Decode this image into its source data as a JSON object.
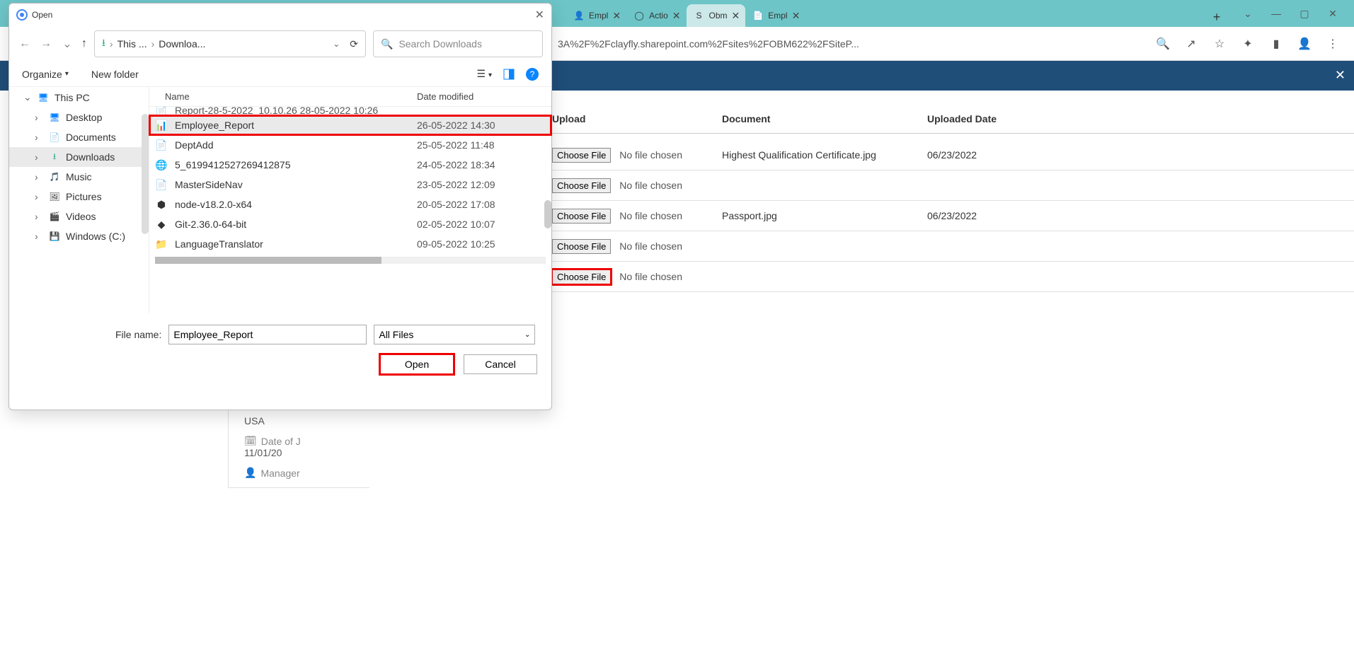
{
  "browser": {
    "tabs": [
      {
        "label": "Empl",
        "favicon": "user-blue"
      },
      {
        "label": "Actio",
        "favicon": "github"
      },
      {
        "label": "Obm",
        "favicon": "sharepoint",
        "active": true
      },
      {
        "label": "Empl",
        "favicon": "file"
      }
    ],
    "url": "3A%2F%2Fclayfly.sharepoint.com%2Fsites%2FOBM622%2FSiteP..."
  },
  "page": {
    "headers": {
      "upload": "Upload",
      "document": "Document",
      "uploaded_date": "Uploaded Date"
    },
    "choose_file_label": "Choose File",
    "no_file_text": "No file chosen",
    "rows": [
      {
        "doc": "Highest Qualification Certificate.jpg",
        "date": "06/23/2022",
        "highlight": false
      },
      {
        "doc": "",
        "date": "",
        "highlight": false
      },
      {
        "doc": "Passport.jpg",
        "date": "06/23/2022",
        "highlight": false
      },
      {
        "doc": "",
        "date": "",
        "highlight": false
      },
      {
        "doc": "",
        "date": "",
        "highlight": true
      }
    ],
    "extra": {
      "country": "USA",
      "doj_label": "Date of J",
      "doj_value": "11/01/20",
      "manager_label": "Manager"
    }
  },
  "dialog": {
    "title": "Open",
    "breadcrumb": {
      "seg1": "This ...",
      "seg2": "Downloa..."
    },
    "search_placeholder": "Search Downloads",
    "organize": "Organize",
    "new_folder": "New folder",
    "sidebar": [
      {
        "label": "This PC",
        "icon": "pc",
        "level": 0
      },
      {
        "label": "Desktop",
        "icon": "desktop",
        "level": 1
      },
      {
        "label": "Documents",
        "icon": "documents",
        "level": 1
      },
      {
        "label": "Downloads",
        "icon": "downloads",
        "level": 1,
        "selected": true
      },
      {
        "label": "Music",
        "icon": "music",
        "level": 1
      },
      {
        "label": "Pictures",
        "icon": "pictures",
        "level": 1
      },
      {
        "label": "Videos",
        "icon": "videos",
        "level": 1
      },
      {
        "label": "Windows (C:)",
        "icon": "drive",
        "level": 1
      }
    ],
    "columns": {
      "name": "Name",
      "date": "Date modified"
    },
    "partial_row": "Report-28-5-2022_10.10.26    28-05-2022 10:26",
    "files": [
      {
        "name": "Employee_Report",
        "date": "26-05-2022 14:30",
        "icon": "excel",
        "selected": true
      },
      {
        "name": "DeptAdd",
        "date": "25-05-2022 11:48",
        "icon": "file"
      },
      {
        "name": "5_6199412527269412875",
        "date": "24-05-2022 18:34",
        "icon": "chrome"
      },
      {
        "name": "MasterSideNav",
        "date": "23-05-2022 12:09",
        "icon": "file"
      },
      {
        "name": "node-v18.2.0-x64",
        "date": "20-05-2022 17:08",
        "icon": "node"
      },
      {
        "name": "Git-2.36.0-64-bit",
        "date": "02-05-2022 10:07",
        "icon": "git"
      },
      {
        "name": "LanguageTranslator",
        "date": "09-05-2022 10:25",
        "icon": "folder"
      }
    ],
    "filename_label": "File name:",
    "filename_value": "Employee_Report",
    "filetype": "All Files",
    "open_btn": "Open",
    "cancel_btn": "Cancel"
  }
}
